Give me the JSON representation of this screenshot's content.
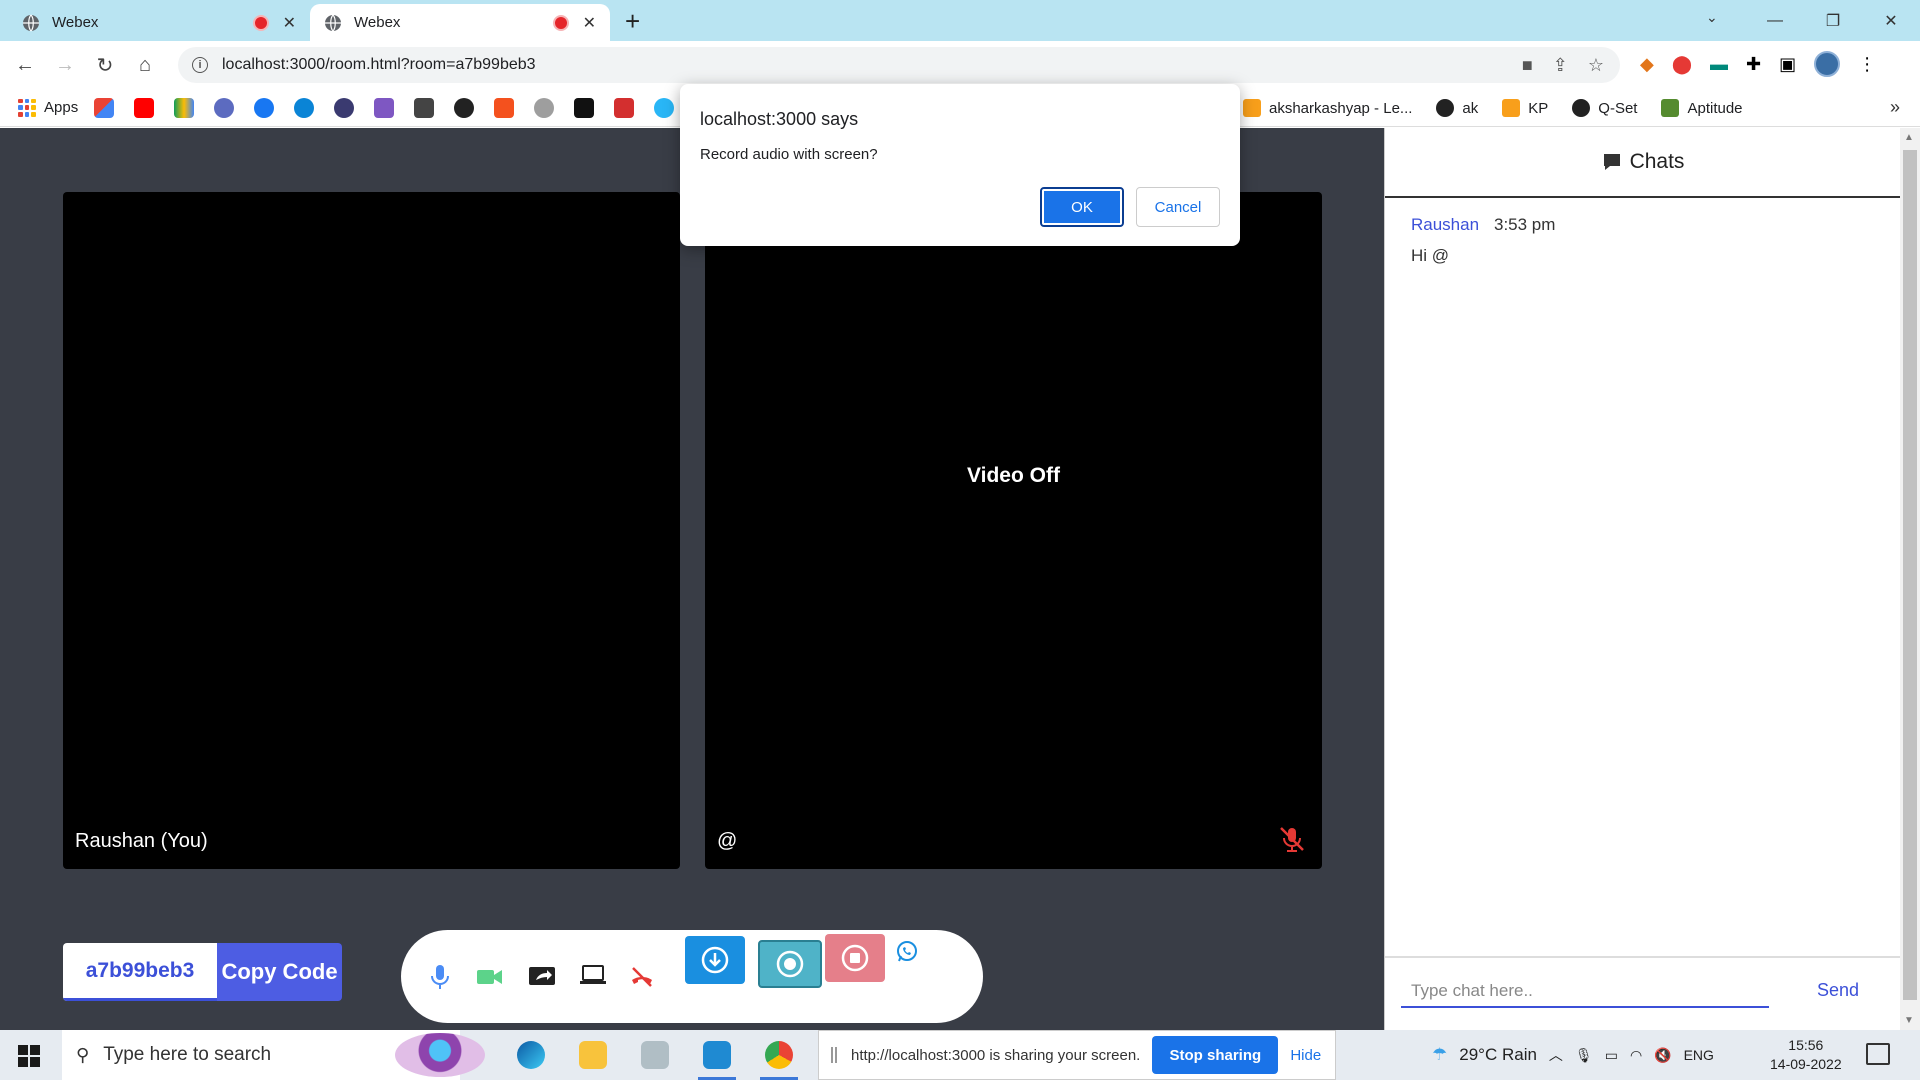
{
  "browser": {
    "tabs": [
      {
        "title": "Webex",
        "active": false
      },
      {
        "title": "Webex",
        "active": true
      }
    ],
    "url": "localhost:3000/room.html?room=a7b99beb3",
    "bookmarks": {
      "apps_label": "Apps",
      "right": [
        "aksharkashyap - Le...",
        "ak",
        "KP",
        "Q-Set",
        "Aptitude"
      ]
    }
  },
  "room": {
    "local_name": "Raushan (You)",
    "remote_name": "@",
    "remote_status": "Video Off",
    "room_code": "a7b99beb3",
    "copy_label": "Copy Code"
  },
  "chat": {
    "title": "Chats",
    "messages": [
      {
        "author": "Raushan",
        "time": "3:53 pm",
        "text": "Hi @"
      }
    ],
    "input_placeholder": "Type chat here..",
    "send_label": "Send"
  },
  "dialog": {
    "title": "localhost:3000 says",
    "message": "Record audio with screen?",
    "ok_label": "OK",
    "cancel_label": "Cancel"
  },
  "taskbar": {
    "search_placeholder": "Type here to search",
    "share_message": "http://localhost:3000 is sharing your screen.",
    "stop_sharing_label": "Stop sharing",
    "hide_label": "Hide",
    "weather": "29°C  Rain",
    "language": "ENG",
    "time": "15:56",
    "date": "14-09-2022"
  },
  "colors": {
    "accent": "#4d5de3",
    "stage_bg": "#393d46",
    "tab_strip": "#b9e4f2",
    "record_button": "#4fb3c8",
    "stop_record_button": "#e57f8a",
    "download_button": "#1a8fe0"
  }
}
